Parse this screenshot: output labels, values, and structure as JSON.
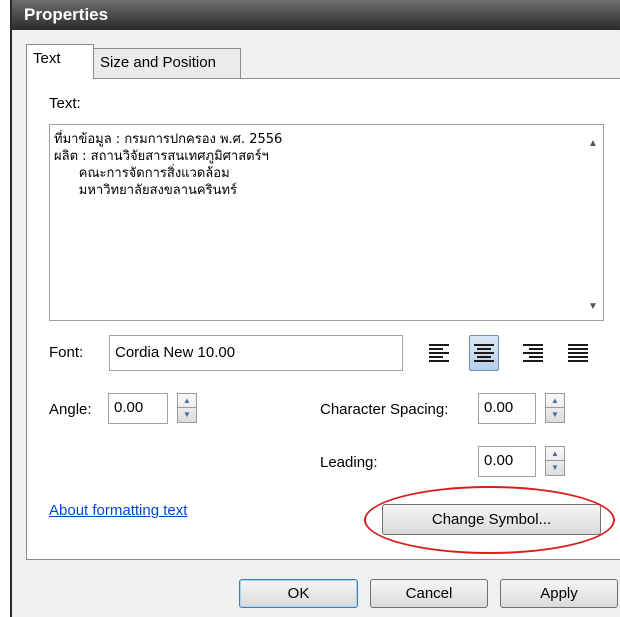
{
  "window": {
    "title": "Properties"
  },
  "tabs": [
    {
      "label": "Text",
      "active": true
    },
    {
      "label": "Size and Position",
      "active": false
    }
  ],
  "text_section": {
    "label": "Text:",
    "lines": [
      "ที่มาข้อมูล : กรมการปกครอง พ.ศ. 2556",
      "ผลิต : สถานวิจัยสารสนเทศภูมิศาสตร์ฯ",
      "      คณะการจัดการสิ่งแวดล้อม",
      "      มหาวิทยาลัยสงขลานครินทร์"
    ]
  },
  "font": {
    "label": "Font:",
    "value": "Cordia New 10.00"
  },
  "alignment": {
    "options": [
      "left",
      "center",
      "right",
      "justify"
    ],
    "selected": "center"
  },
  "angle": {
    "label": "Angle:",
    "value": "0.00"
  },
  "character_spacing": {
    "label": "Character Spacing:",
    "value": "0.00"
  },
  "leading": {
    "label": "Leading:",
    "value": "0.00"
  },
  "link": {
    "label": "About formatting text"
  },
  "change_symbol_button": {
    "label": "Change Symbol..."
  },
  "footer": {
    "ok_label": "OK",
    "cancel_label": "Cancel",
    "apply_label": "Apply"
  },
  "colors": {
    "title_bar": "#2a2a2a",
    "highlight_ellipse": "#d81e1e",
    "link": "#0645d0"
  }
}
